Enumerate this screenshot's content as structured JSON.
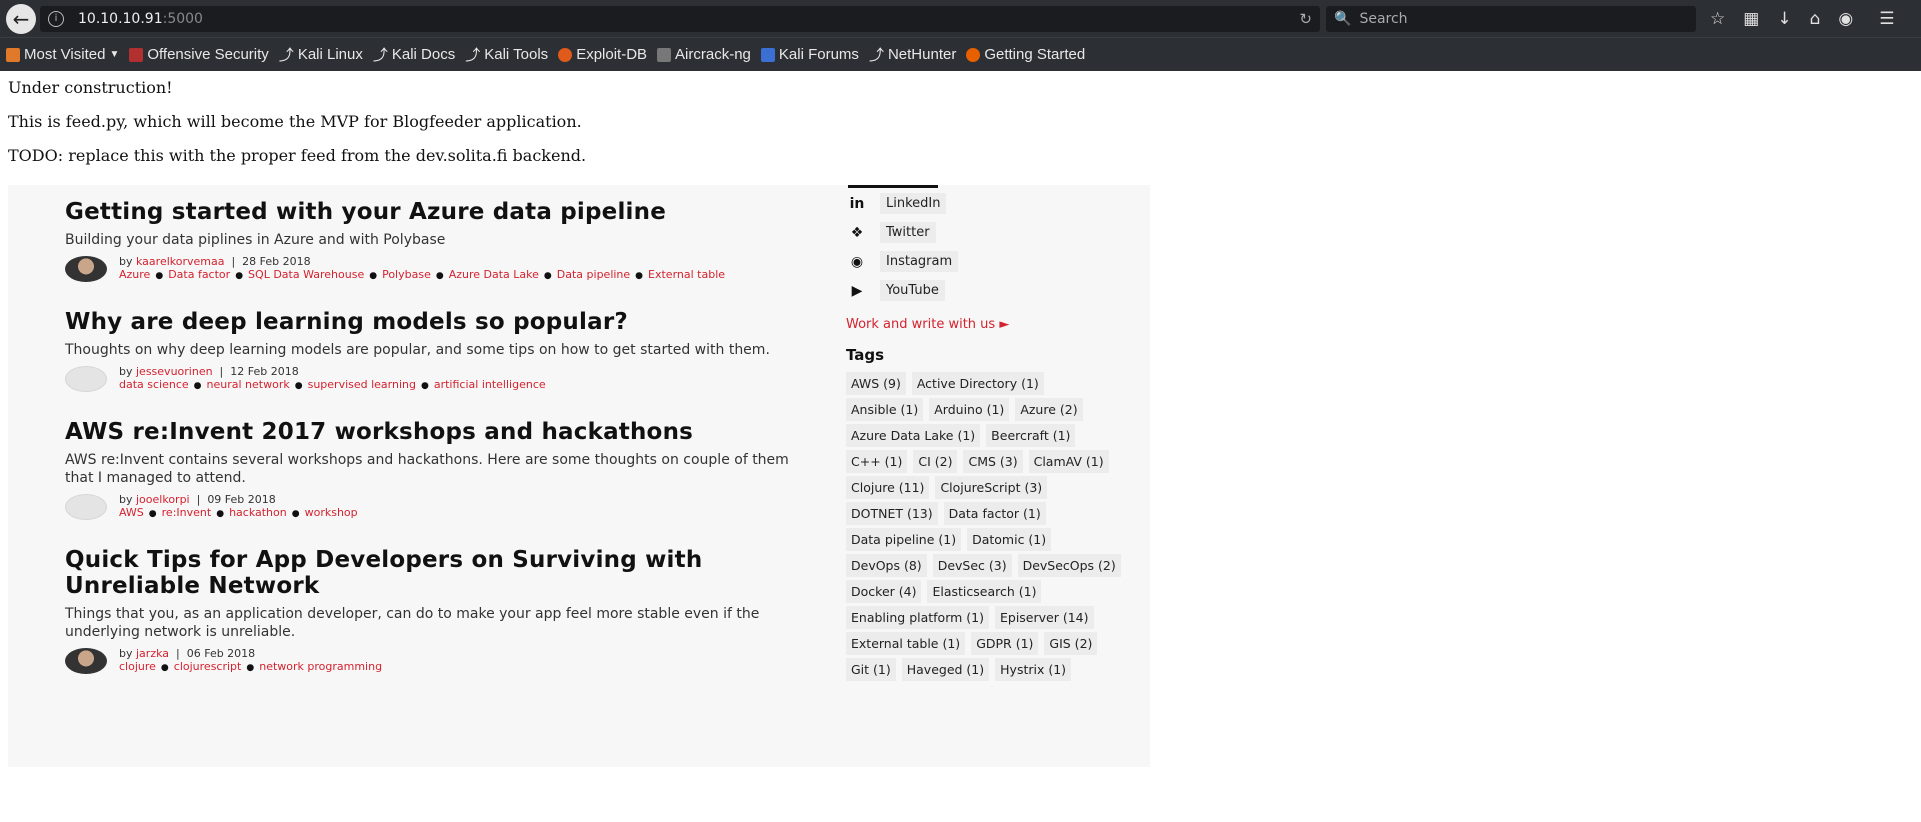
{
  "browser": {
    "url_host": "10.10.10.91",
    "url_port": ":5000",
    "search_placeholder": "Search"
  },
  "bookmarks": [
    {
      "label": "Most Visited",
      "color": "#e0792a"
    },
    {
      "label": "Offensive Security",
      "color": "#b33030"
    },
    {
      "label": "Kali Linux",
      "color": "#222222"
    },
    {
      "label": "Kali Docs",
      "color": "#222222"
    },
    {
      "label": "Kali Tools",
      "color": "#222222"
    },
    {
      "label": "Exploit-DB",
      "color": "#e05a1c"
    },
    {
      "label": "Aircrack-ng",
      "color": "#555555"
    },
    {
      "label": "Kali Forums",
      "color": "#3b6fd1"
    },
    {
      "label": "NetHunter",
      "color": "#222222"
    },
    {
      "label": "Getting Started",
      "color": "#e66000"
    }
  ],
  "page": {
    "line1": "Under construction!",
    "line2": "This is feed.py, which will become the MVP for Blogfeeder application.",
    "line3": "TODO: replace this with the proper feed from the dev.solita.fi backend."
  },
  "articles": [
    {
      "title": "Getting started with your Azure data pipeline",
      "desc": "Building your data piplines in Azure and with Polybase",
      "by": "by",
      "author": "kaarelkorvemaa",
      "date": "28 Feb 2018",
      "tags": [
        "Azure",
        "Data factor",
        "SQL Data Warehouse",
        "Polybase",
        "Azure Data Lake",
        "Data pipeline",
        "External table"
      ],
      "avatar": "photo"
    },
    {
      "title": "Why are deep learning models so popular?",
      "desc": "Thoughts on why deep learning models are popular, and some tips on how to get started with them.",
      "by": "by",
      "author": "jessevuorinen",
      "date": "12 Feb 2018",
      "tags": [
        "data science",
        "neural network",
        "supervised learning",
        "artificial intelligence"
      ],
      "avatar": "blank"
    },
    {
      "title": "AWS re:Invent 2017 workshops and hackathons",
      "desc": "AWS re:Invent contains several workshops and hackathons. Here are some thoughts on couple of them that I managed to attend.",
      "by": "by",
      "author": "jooelkorpi",
      "date": "09 Feb 2018",
      "tags": [
        "AWS",
        "re:Invent",
        "hackathon",
        "workshop"
      ],
      "avatar": "blank"
    },
    {
      "title": "Quick Tips for App Developers on Surviving with Unreliable Network",
      "desc": "Things that you, as an application developer, can do to make your app feel more stable even if the underlying network is unreliable.",
      "by": "by",
      "author": "jarzka",
      "date": "06 Feb 2018",
      "tags": [
        "clojure",
        "clojurescript",
        "network programming"
      ],
      "avatar": "photo"
    }
  ],
  "sidebar": {
    "social": [
      {
        "label": "LinkedIn",
        "icon": "linkedin-icon",
        "glyph": "in"
      },
      {
        "label": "Twitter",
        "icon": "twitter-icon",
        "glyph": "🐦"
      },
      {
        "label": "Instagram",
        "icon": "instagram-icon",
        "glyph": "◎"
      },
      {
        "label": "YouTube",
        "icon": "youtube-icon",
        "glyph": "▶"
      }
    ],
    "work_link": "Work and write with us ►",
    "tags_title": "Tags",
    "tags": [
      "AWS (9)",
      "Active Directory (1)",
      "Ansible (1)",
      "Arduino (1)",
      "Azure (2)",
      "Azure Data Lake (1)",
      "Beercraft (1)",
      "C++ (1)",
      "CI (2)",
      "CMS (3)",
      "ClamAV (1)",
      "Clojure (11)",
      "ClojureScript (3)",
      "DOTNET (13)",
      "Data factor (1)",
      "Data pipeline (1)",
      "Datomic (1)",
      "DevOps (8)",
      "DevSec (3)",
      "DevSecOps (2)",
      "Docker (4)",
      "Elasticsearch (1)",
      "Enabling platform (1)",
      "Episerver (14)",
      "External table (1)",
      "GDPR (1)",
      "GIS (2)",
      "Git (1)",
      "Haveged (1)",
      "Hystrix (1)"
    ]
  }
}
